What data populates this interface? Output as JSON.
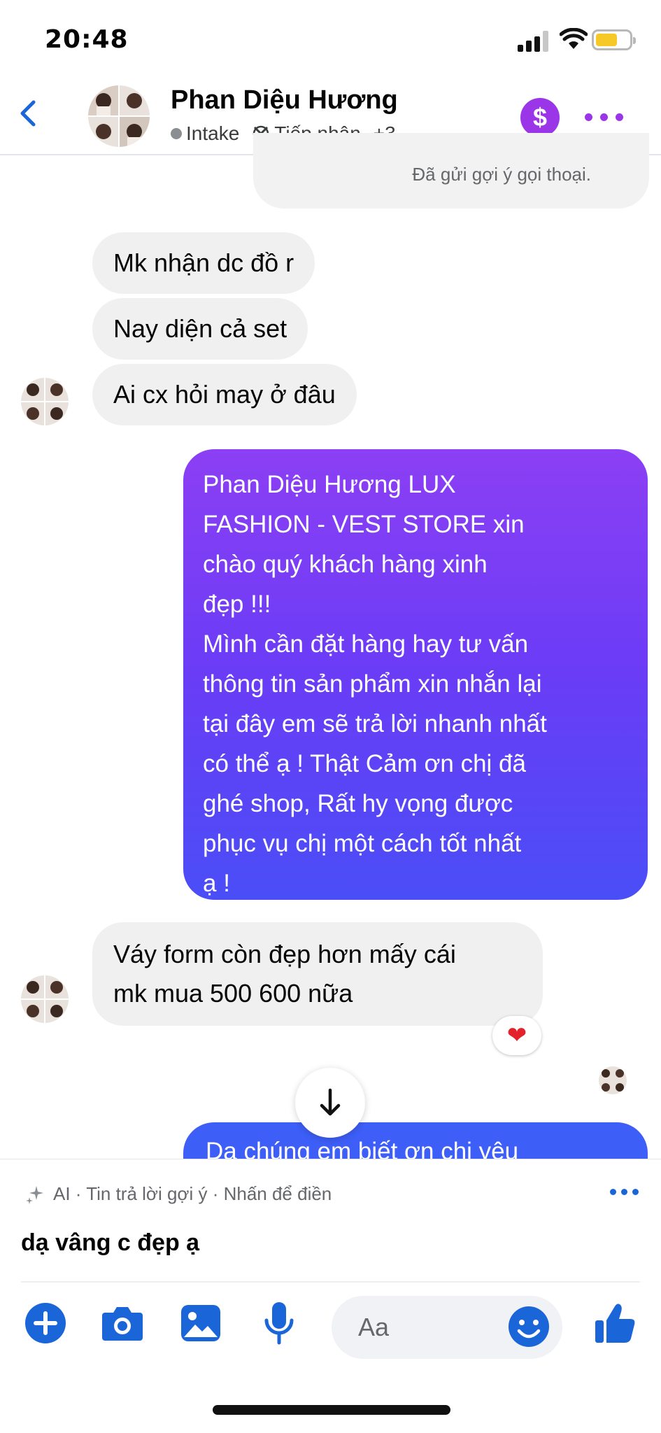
{
  "status_bar": {
    "time": "20:48"
  },
  "header": {
    "contact_name": "Phan Diệu Hương",
    "tags": [
      "Intake",
      "Tiếp nhận"
    ],
    "more_tags": "+3"
  },
  "messages": {
    "system_note": "Đã gửi gợi ý gọi thoại.",
    "incoming_1": [
      "Mk nhận dc đồ r",
      "Nay diện cả set",
      "Ai cx hỏi may ở đâu"
    ],
    "outgoing_1": [
      "Phan Diệu Hương LUX",
      "FASHION - VEST STORE xin",
      "chào quý khách hàng xinh",
      "đẹp !!!",
      "Mình cần đặt hàng hay tư vấn",
      "thông tin sản phẩm xin nhắn lại",
      "tại đây em sẽ trả lời nhanh nhất",
      "có thể ạ ! Thật Cảm ơn chị đã",
      "ghé shop, Rất hy vọng được",
      "phục vụ chị một cách tốt nhất",
      "ạ !"
    ],
    "incoming_2": [
      "Váy form còn đẹp hơn mấy cái",
      "mk mua 500 600 nữa"
    ],
    "reaction": "❤",
    "outgoing_2_partial": "Dạ chúng em biết ơn chị yêu"
  },
  "suggestions": {
    "ai_label": "AI · Tin trả lời gợi ý · Nhấn để điền",
    "suggested_reply": "dạ vâng c đẹp ạ"
  },
  "composer": {
    "placeholder": "Aa"
  },
  "colors": {
    "accent": "#1a66d9",
    "purple": "#9b35e8",
    "bubble_in": "#f0f0f0"
  }
}
